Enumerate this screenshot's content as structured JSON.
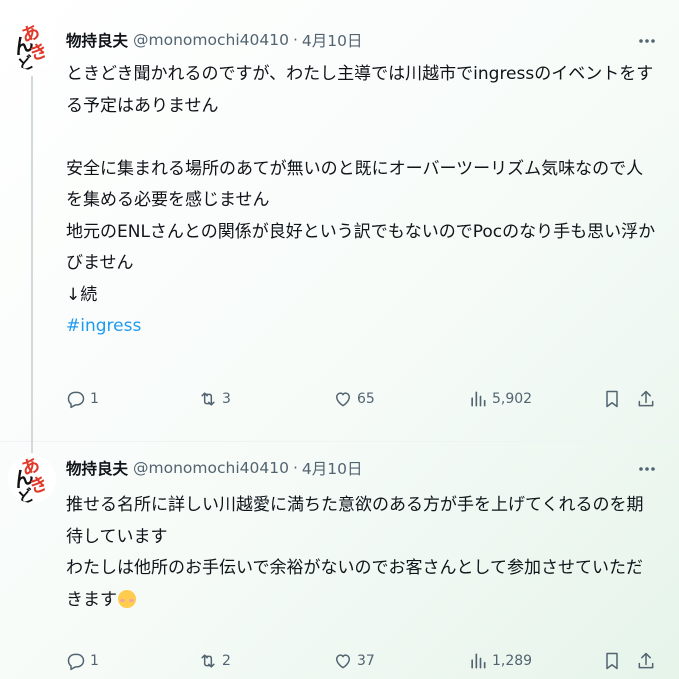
{
  "tweets": [
    {
      "name": "物持良夫",
      "handle": "@monomochi40410",
      "dot": "·",
      "date": "4月10日",
      "avatar_text": "あきんどさ",
      "lines": [
        "ときどき聞かれるのですが、わたし主導では川越市でingressのイベントをす",
        "る予定はありません",
        "",
        "安全に集まれる場所のあてが無いのと既にオーバーツーリズム気味なので人",
        "を集める必要を感じません",
        "地元のENLさんとの関係が良好という訳でもないのでPocのなり手も思い浮か",
        "びません",
        "↓続"
      ],
      "hashtag": "#ingress",
      "replies": "1",
      "reposts": "3",
      "likes": "65",
      "views": "5,902"
    },
    {
      "name": "物持良夫",
      "handle": "@monomochi40410",
      "dot": "·",
      "date": "4月10日",
      "avatar_text": "あきんどさ",
      "lines": [
        "推せる名所に詳しい川越愛に満ちた意欲のある方が手を上げてくれるのを期",
        "待しています",
        "わたしは他所のお手伝いで余裕がないのでお客さんとして参加させていただ",
        "きます"
      ],
      "replies": "1",
      "reposts": "2",
      "likes": "37",
      "views": "1,289"
    }
  ],
  "colors": {
    "text": "#0f1419",
    "secondary": "#536471",
    "hashtag": "#1d9bf0",
    "avatar_red": "#e0392b"
  },
  "icons": [
    "reply-icon",
    "repost-icon",
    "like-icon",
    "views-icon",
    "bookmark-icon",
    "share-icon",
    "more-icon"
  ]
}
